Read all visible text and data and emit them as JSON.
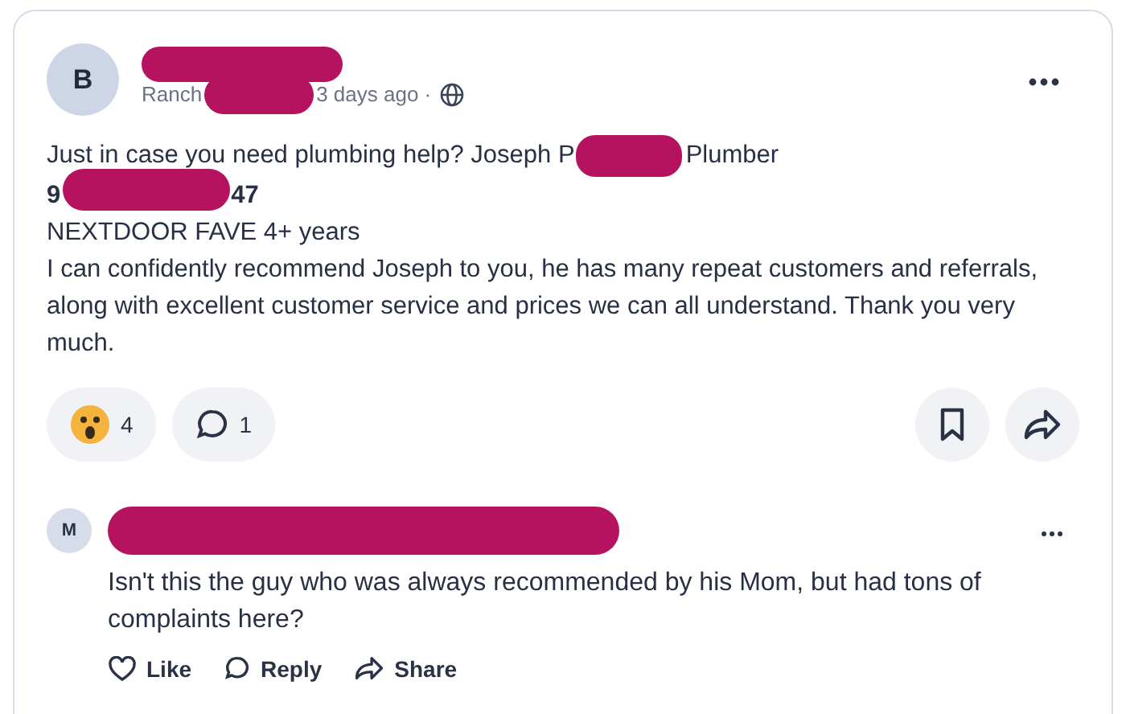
{
  "post": {
    "avatar_initial": "B",
    "location": "Ranch",
    "time": "3 days ago ·",
    "body": {
      "line_1_start": "Just in case you need plumbing help? Joseph P",
      "line_1_end": "Plumber",
      "line_2_start": "9",
      "line_2_end": "47",
      "paragraphs": [
        "NEXTDOOR FAVE 4+ years",
        "I can confidently recommend Joseph to you, he has many repeat customers and referrals, along with excellent customer service and prices we can all understand. Thank you very much."
      ]
    },
    "reaction_count": "4",
    "comment_count": "1"
  },
  "comment": {
    "avatar_initial": "M",
    "text": "Isn't this the guy who was always recommended by his Mom, but had tons of complaints here?",
    "actions": [
      {
        "kind": "like",
        "label": "Like"
      },
      {
        "kind": "reply",
        "label": "Reply"
      },
      {
        "kind": "share",
        "label": "Share"
      }
    ]
  }
}
